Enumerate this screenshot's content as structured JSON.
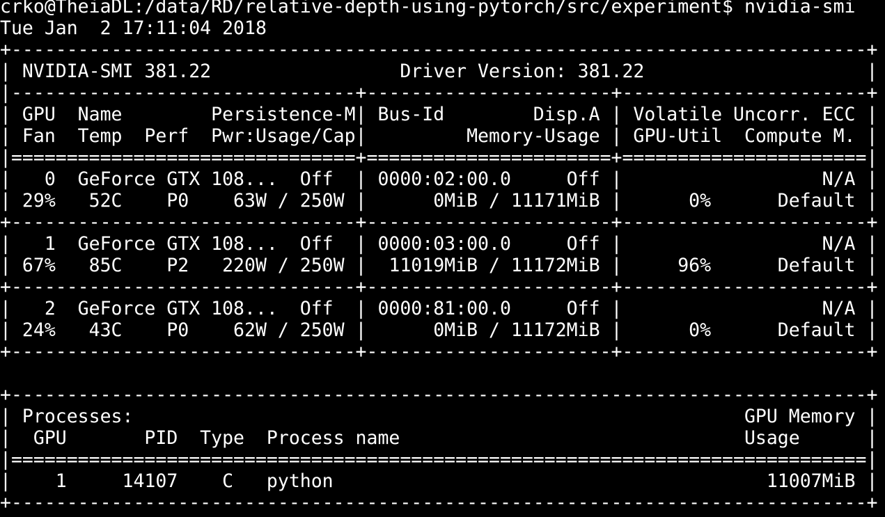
{
  "terminal": {
    "background": "#000000",
    "foreground": "#ffffff",
    "lines": [
      "crko@TheiaDL:/data/RD/relative-depth-using-pytorch/src/experiment$ nvidia-smi",
      "Tue Jan  2 17:11:04 2018",
      "+-----------------------------------------------------------------------------+",
      "| NVIDIA-SMI 381.22                 Driver Version: 381.22                    |",
      "|-------------------------------+----------------------+----------------------+",
      "| GPU  Name        Persistence-M| Bus-Id        Disp.A | Volatile Uncorr. ECC |",
      "| Fan  Temp  Perf  Pwr:Usage/Cap|         Memory-Usage | GPU-Util  Compute M. |",
      "|===============================+======================+======================|",
      "|   0  GeForce GTX 108...  Off  | 0000:02:00.0     Off |                  N/A |",
      "| 29%   52C    P0    63W / 250W |      0MiB / 11171MiB |      0%      Default |",
      "+-------------------------------+----------------------+----------------------+",
      "|   1  GeForce GTX 108...  Off  | 0000:03:00.0     Off |                  N/A |",
      "| 67%   85C    P2   220W / 250W |  11019MiB / 11172MiB |     96%      Default |",
      "+-------------------------------+----------------------+----------------------+",
      "|   2  GeForce GTX 108...  Off  | 0000:81:00.0     Off |                  N/A |",
      "| 24%   43C    P0    62W / 250W |      0MiB / 11172MiB |      0%      Default |",
      "+-------------------------------+----------------------+----------------------+",
      "",
      "+-----------------------------------------------------------------------------+",
      "| Processes:                                                       GPU Memory |",
      "|  GPU       PID  Type  Process name                               Usage      |",
      "|=============================================================================|",
      "|    1     14107    C   python                                       11007MiB |",
      "+-----------------------------------------------------------------------------+"
    ]
  }
}
